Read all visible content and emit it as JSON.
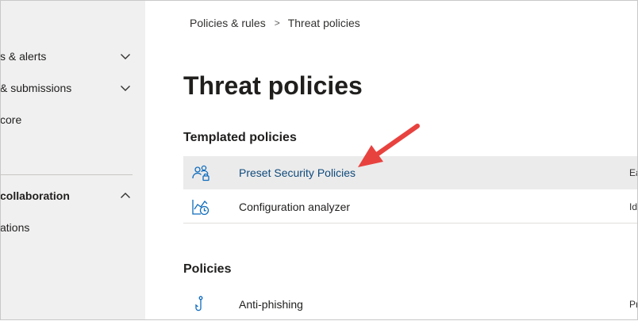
{
  "sidebar": {
    "items": [
      {
        "label": "s & alerts",
        "chevron": "down"
      },
      {
        "label": "& submissions",
        "chevron": "down"
      },
      {
        "label": "core",
        "chevron": ""
      },
      {
        "label": " collaboration",
        "chevron": "up"
      },
      {
        "label": "ations",
        "chevron": ""
      }
    ]
  },
  "breadcrumb": {
    "parent": "Policies & rules",
    "separator": ">",
    "current": "Threat policies"
  },
  "page": {
    "title": "Threat policies"
  },
  "templated": {
    "heading": "Templated policies",
    "rows": [
      {
        "label": "Preset Security Policies",
        "desc": "Ea",
        "icon": "users-lock-icon",
        "selected": true
      },
      {
        "label": "Configuration analyzer",
        "desc": "Id",
        "icon": "chart-clock-icon",
        "selected": false
      }
    ]
  },
  "policies": {
    "heading": "Policies",
    "rows": [
      {
        "label": "Anti-phishing",
        "desc": "Pr",
        "icon": "fishhook-icon"
      }
    ]
  },
  "annotation": {
    "color": "#e8423f",
    "points_to": "Preset Security Policies"
  },
  "colors": {
    "sidebar_bg": "#f0f0f0",
    "selected_row_bg": "#ebebeb",
    "link_blue": "#0f4a7c",
    "icon_blue": "#0f6cbd"
  }
}
